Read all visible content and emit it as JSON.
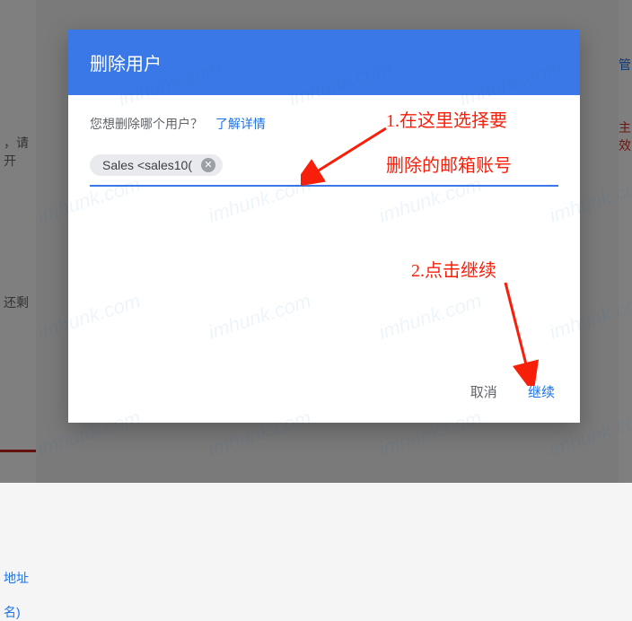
{
  "background": {
    "left_text": "，请开",
    "left_text2": "还剩",
    "left_link1": "地址",
    "left_link2": "名)",
    "right_text1": "管",
    "right_text2": "主效"
  },
  "dialog": {
    "title": "删除用户",
    "prompt": "您想删除哪个用户？",
    "learn_more": "了解详情",
    "chip_value": "Sales <sales10(",
    "cancel": "取消",
    "continue": "继续"
  },
  "annotations": {
    "step1_line1": "1.在这里选择要",
    "step1_line2": "删除的邮箱账号",
    "step2": "2.点击继续"
  },
  "watermark": "imhunk.com"
}
